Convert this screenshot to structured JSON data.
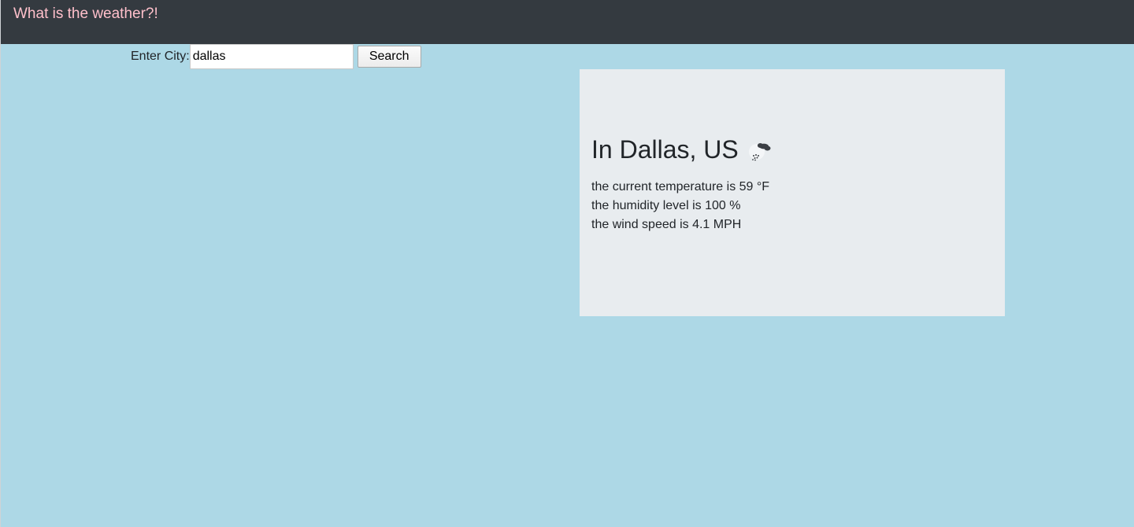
{
  "navbar": {
    "brand": "What is the weather?!"
  },
  "search": {
    "label": "Enter City:",
    "value": "dallas",
    "button_label": "Search"
  },
  "weather": {
    "heading": "In Dallas, US",
    "icon": "rain-cloud-icon",
    "temperature_line": "the current temperature is 59 °F",
    "humidity_line": "the humidity level is 100 %",
    "wind_line": "the wind speed is 4.1 MPH"
  },
  "colors": {
    "page_background": "#add8e6",
    "navbar_background": "#343a40",
    "brand_text": "#ffc0cb",
    "card_background": "#e8ecef"
  }
}
